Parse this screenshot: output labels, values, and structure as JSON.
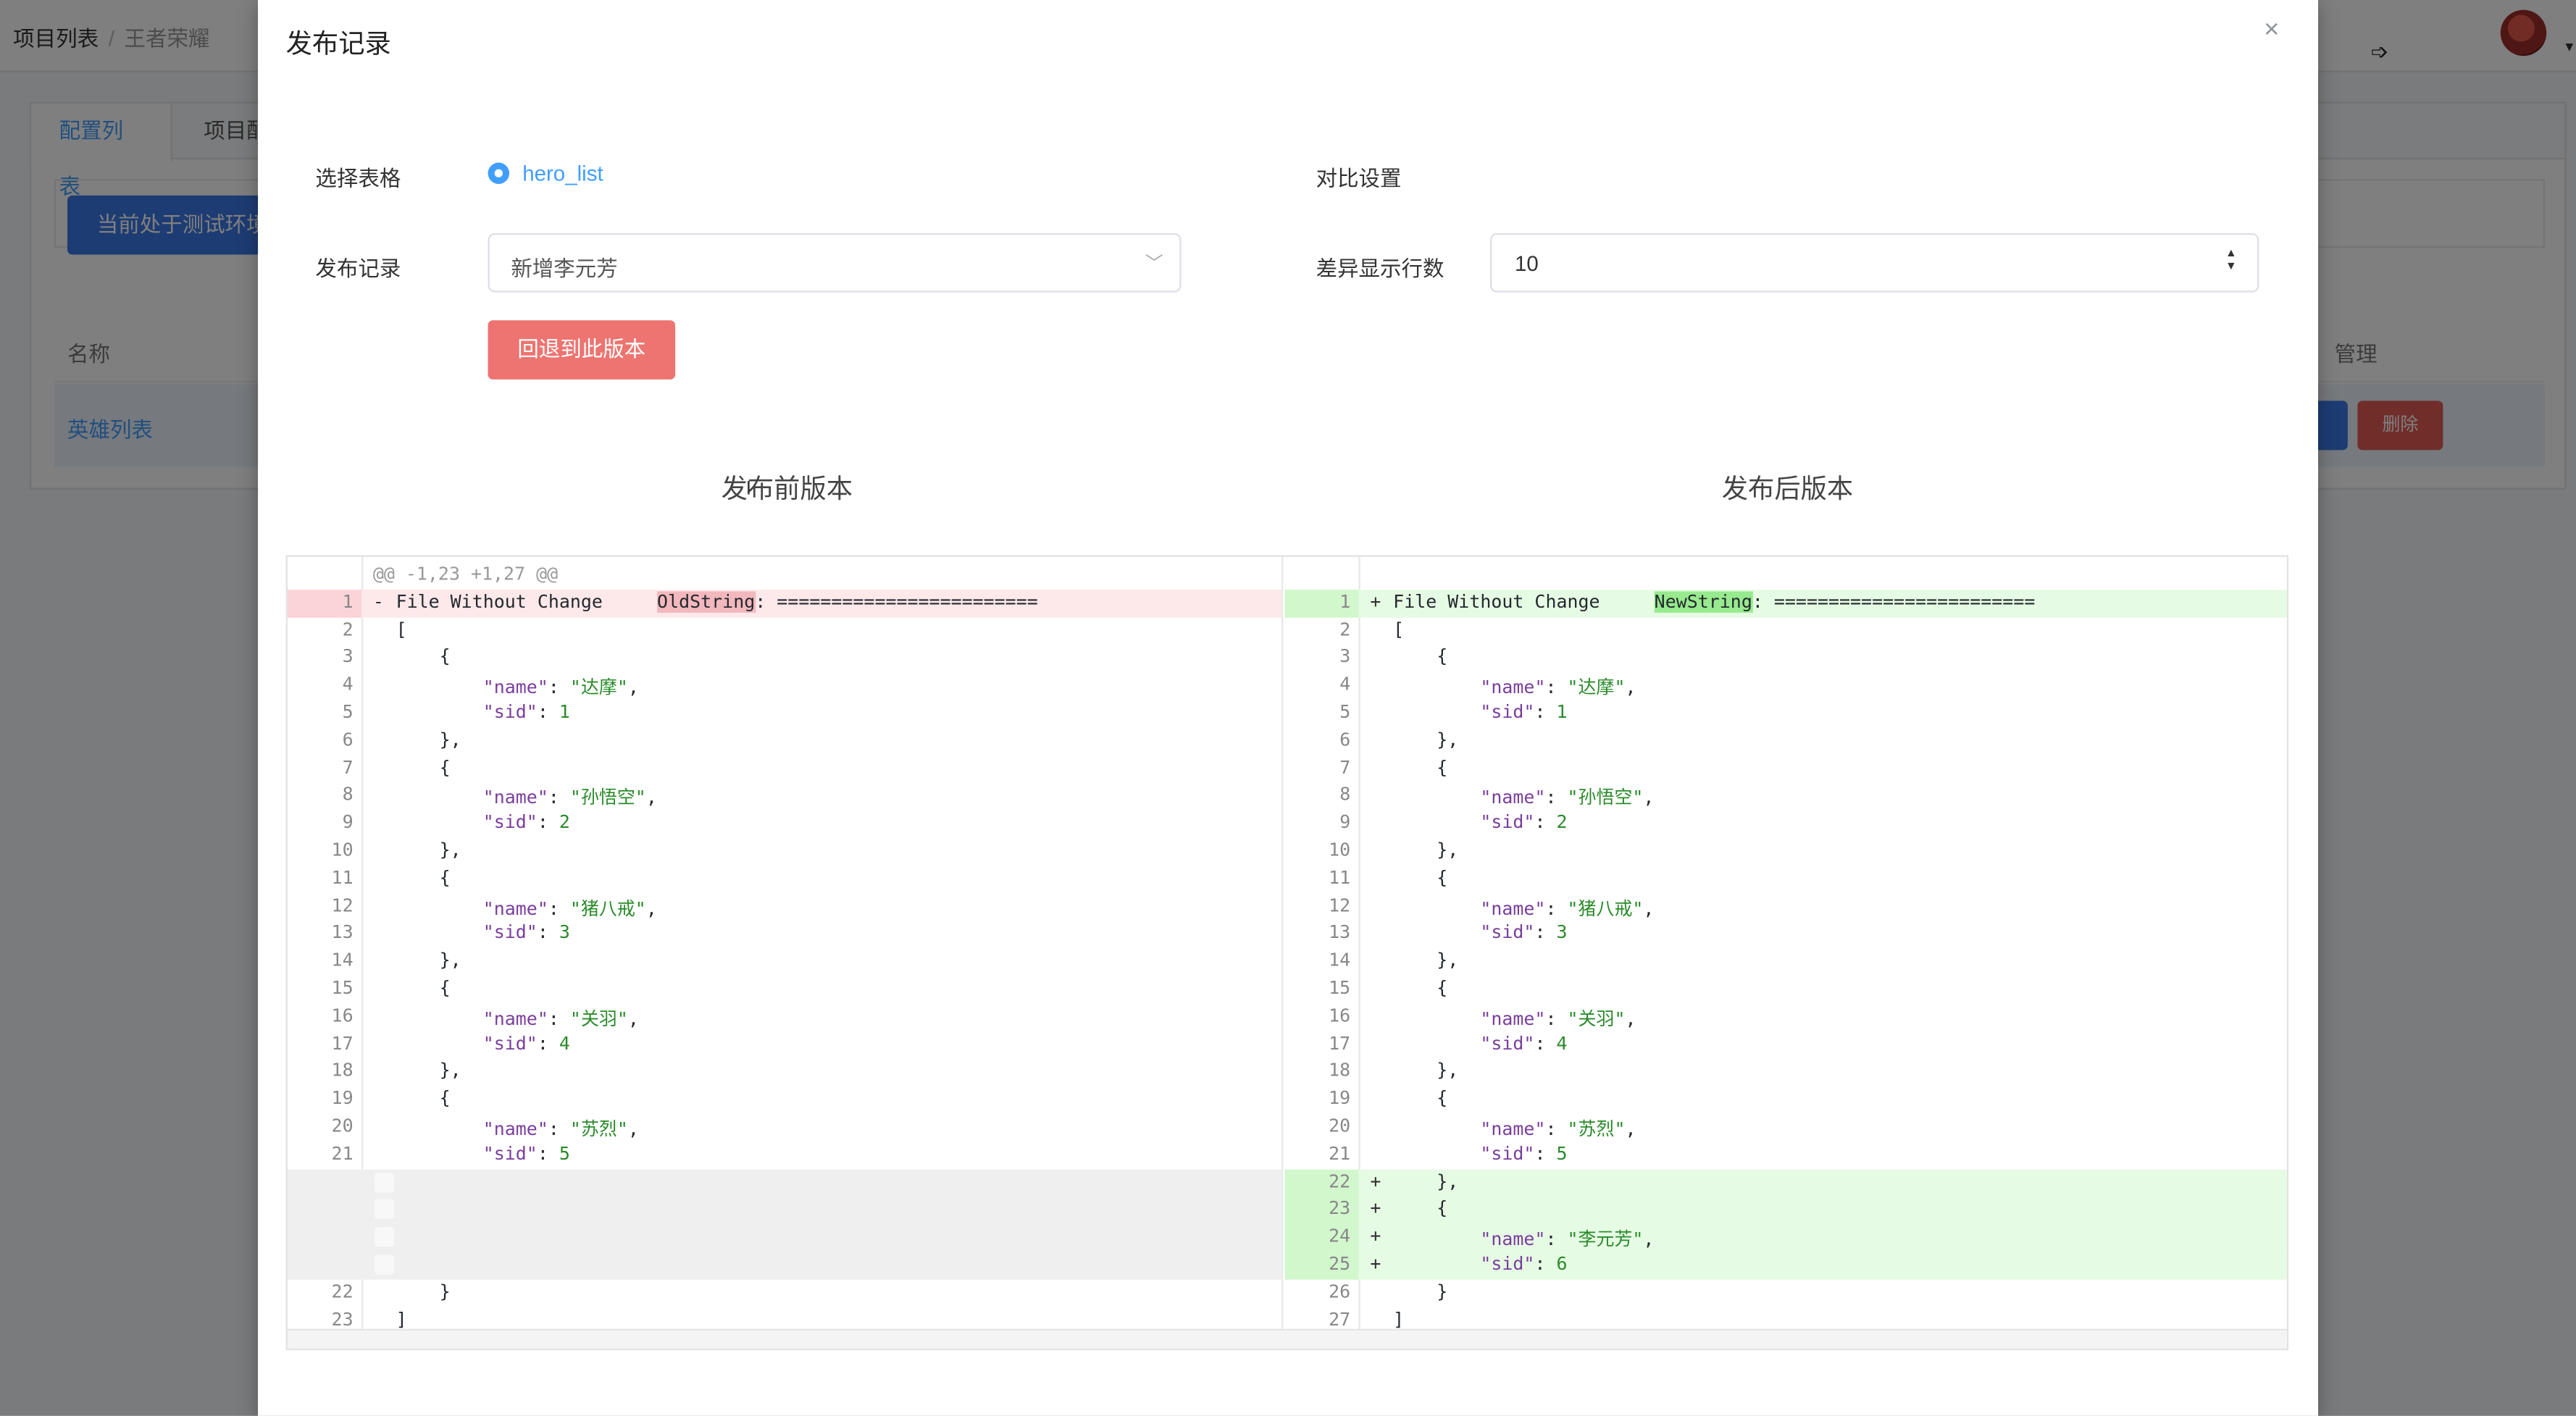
{
  "breadcrumb": {
    "root": "项目列表",
    "separator": "/",
    "current": "王者荣耀"
  },
  "header": {
    "avatar_icon": "avatar",
    "logout_icon": "logout-icon"
  },
  "background": {
    "tabs": [
      "配置列表",
      "项目配"
    ],
    "env_button": "当前处于测试环境",
    "table_headers": {
      "name": "名称",
      "manage": "管理"
    },
    "row_link": "英雄列表",
    "delete_label": "删除"
  },
  "dialog": {
    "title": "发布记录",
    "close_icon": "×",
    "select_table_label": "选择表格",
    "table_option": "hero_list",
    "compare_label": "对比设置",
    "record_label": "发布记录",
    "record_value": "新增李元芳",
    "diff_rows_label": "差异显示行数",
    "diff_rows_value": "10",
    "rollback_button": "回退到此版本",
    "before_title": "发布前版本",
    "after_title": "发布后版本"
  },
  "diff": {
    "hunk_header": "@@ -1,23 +1,27 @@",
    "left": [
      {
        "n": "1",
        "type": "del",
        "mk": "-",
        "text": "File Without Change     OldString: ========================"
      },
      {
        "n": "2",
        "text": "["
      },
      {
        "n": "3",
        "text": "    {"
      },
      {
        "n": "4",
        "text": "        \"name\": \"达摩\","
      },
      {
        "n": "5",
        "text": "        \"sid\": 1"
      },
      {
        "n": "6",
        "text": "    },"
      },
      {
        "n": "7",
        "text": "    {"
      },
      {
        "n": "8",
        "text": "        \"name\": \"孙悟空\","
      },
      {
        "n": "9",
        "text": "        \"sid\": 2"
      },
      {
        "n": "10",
        "text": "    },"
      },
      {
        "n": "11",
        "text": "    {"
      },
      {
        "n": "12",
        "text": "        \"name\": \"猪八戒\","
      },
      {
        "n": "13",
        "text": "        \"sid\": 3"
      },
      {
        "n": "14",
        "text": "    },"
      },
      {
        "n": "15",
        "text": "    {"
      },
      {
        "n": "16",
        "text": "        \"name\": \"关羽\","
      },
      {
        "n": "17",
        "text": "        \"sid\": 4"
      },
      {
        "n": "18",
        "text": "    },"
      },
      {
        "n": "19",
        "text": "    {"
      },
      {
        "n": "20",
        "text": "        \"name\": \"苏烈\","
      },
      {
        "n": "21",
        "text": "        \"sid\": 5"
      },
      {
        "n": "",
        "type": "empty",
        "text": ""
      },
      {
        "n": "",
        "type": "empty",
        "text": ""
      },
      {
        "n": "",
        "type": "empty",
        "text": ""
      },
      {
        "n": "",
        "type": "empty",
        "text": ""
      },
      {
        "n": "22",
        "text": "    }"
      },
      {
        "n": "23",
        "text": "]"
      }
    ],
    "right": [
      {
        "n": "1",
        "type": "add",
        "mk": "+",
        "text": "File Without Change     NewString: ========================"
      },
      {
        "n": "2",
        "text": "["
      },
      {
        "n": "3",
        "text": "    {"
      },
      {
        "n": "4",
        "text": "        \"name\": \"达摩\","
      },
      {
        "n": "5",
        "text": "        \"sid\": 1"
      },
      {
        "n": "6",
        "text": "    },"
      },
      {
        "n": "7",
        "text": "    {"
      },
      {
        "n": "8",
        "text": "        \"name\": \"孙悟空\","
      },
      {
        "n": "9",
        "text": "        \"sid\": 2"
      },
      {
        "n": "10",
        "text": "    },"
      },
      {
        "n": "11",
        "text": "    {"
      },
      {
        "n": "12",
        "text": "        \"name\": \"猪八戒\","
      },
      {
        "n": "13",
        "text": "        \"sid\": 3"
      },
      {
        "n": "14",
        "text": "    },"
      },
      {
        "n": "15",
        "text": "    {"
      },
      {
        "n": "16",
        "text": "        \"name\": \"关羽\","
      },
      {
        "n": "17",
        "text": "        \"sid\": 4"
      },
      {
        "n": "18",
        "text": "    },"
      },
      {
        "n": "19",
        "text": "    {"
      },
      {
        "n": "20",
        "text": "        \"name\": \"苏烈\","
      },
      {
        "n": "21",
        "text": "        \"sid\": 5"
      },
      {
        "n": "22",
        "type": "add",
        "mk": "+",
        "text": "    },"
      },
      {
        "n": "23",
        "type": "add",
        "mk": "+",
        "text": "    {"
      },
      {
        "n": "24",
        "type": "add",
        "mk": "+",
        "text": "        \"name\": \"李元芳\","
      },
      {
        "n": "25",
        "type": "add",
        "mk": "+",
        "text": "        \"sid\": 6"
      },
      {
        "n": "26",
        "text": "    }"
      },
      {
        "n": "27",
        "text": "]"
      }
    ]
  },
  "colors": {
    "primary": "#409eff",
    "danger": "#ed7470",
    "del_bg": "#fde8ea",
    "add_bg": "#e6fbe4"
  }
}
